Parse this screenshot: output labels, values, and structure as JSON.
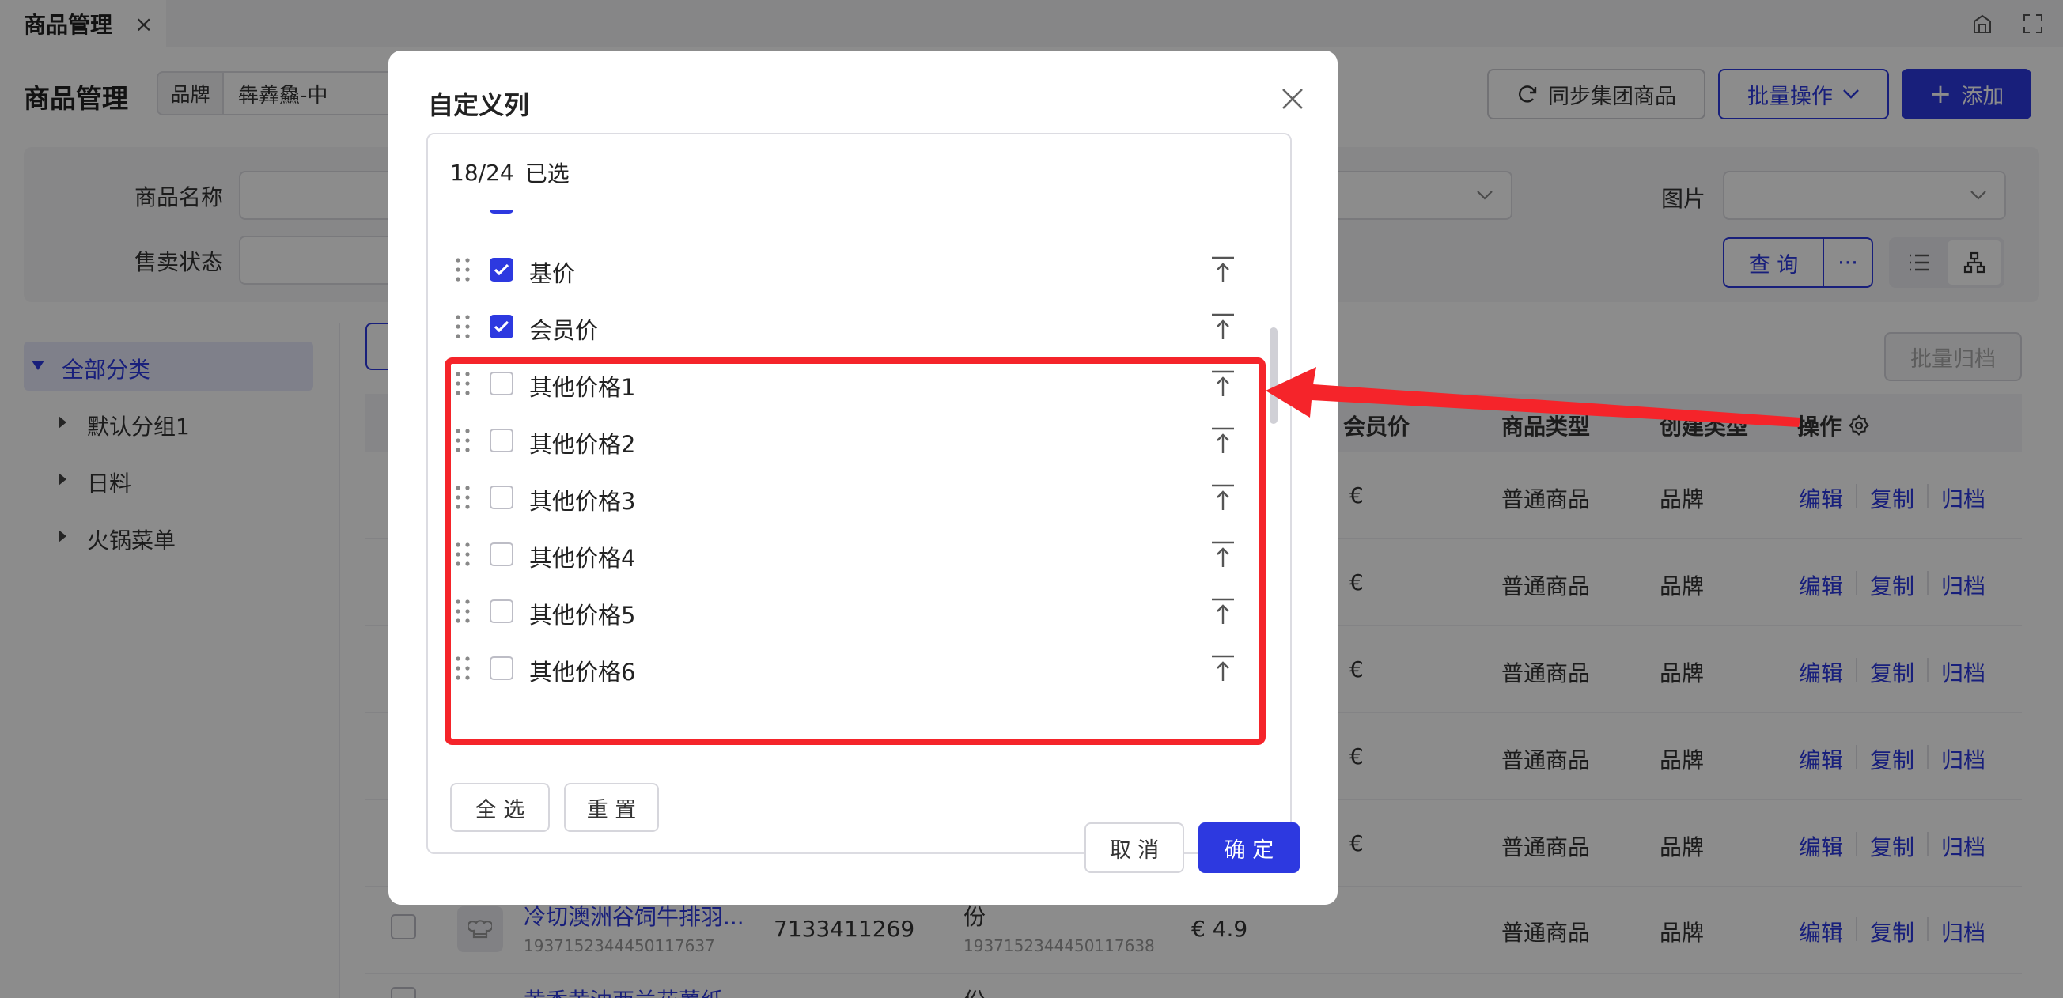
{
  "tab": {
    "title": "商品管理",
    "close": "×"
  },
  "header": {
    "title": "商品管理",
    "brand_label": "品牌",
    "brand_value": "犇羴鱻-中",
    "sync_label": "同步集团商品",
    "batch_label": "批量操作",
    "add_label": "添加"
  },
  "filters": {
    "name_label": "商品名称",
    "status_label": "售卖状态",
    "image_label": "图片",
    "query_label": "查 询",
    "more_label": "···"
  },
  "sidebar": {
    "items": [
      {
        "label": "全部分类"
      },
      {
        "label": "默认分组1"
      },
      {
        "label": "日料"
      },
      {
        "label": "火锅菜单"
      }
    ]
  },
  "table": {
    "archive_label": "批量归档",
    "headers": [
      "会员价",
      "商品类型",
      "创建类型",
      "操作"
    ],
    "rows": [
      {
        "price": "€",
        "type": "普通商品",
        "creator": "品牌"
      },
      {
        "price": "€",
        "type": "普通商品",
        "creator": "品牌"
      },
      {
        "price": "€",
        "type": "普通商品",
        "creator": "品牌"
      },
      {
        "price": "€",
        "type": "普通商品",
        "creator": "品牌"
      },
      {
        "price": "€",
        "type": "普通商品",
        "creator": "品牌"
      },
      {
        "name": "冷切澳洲谷饲牛排羽...",
        "name_id": "1937152344450117637",
        "code": "7133411269",
        "unit": "份",
        "unit_id": "1937152344450117638",
        "price": "€  4.9",
        "type": "普通商品",
        "creator": "品牌"
      }
    ],
    "actions": [
      "编辑",
      "复制",
      "归档"
    ],
    "partial_bottom": {
      "name": "黄香黄油西兰花薯纸",
      "unit": "份"
    }
  },
  "modal": {
    "title": "自定义列",
    "count": "18/24",
    "selected_label": "已选",
    "items": [
      {
        "label": "基价",
        "checked": true
      },
      {
        "label": "会员价",
        "checked": true
      },
      {
        "label": "其他价格1",
        "checked": false
      },
      {
        "label": "其他价格2",
        "checked": false
      },
      {
        "label": "其他价格3",
        "checked": false
      },
      {
        "label": "其他价格4",
        "checked": false
      },
      {
        "label": "其他价格5",
        "checked": false
      },
      {
        "label": "其他价格6",
        "checked": false
      }
    ],
    "select_all_label": "全 选",
    "reset_label": "重 置",
    "cancel_label": "取 消",
    "confirm_label": "确 定"
  },
  "colors": {
    "accent": "#2d39e0",
    "highlight": "#f5242a"
  }
}
